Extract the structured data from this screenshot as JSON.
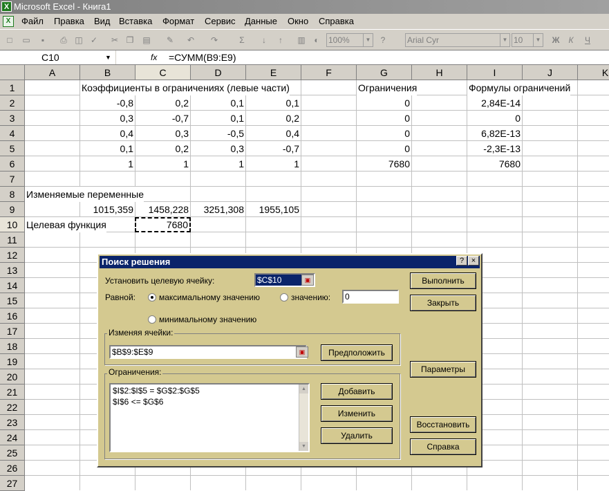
{
  "window": {
    "title": "Microsoft Excel - Книга1"
  },
  "menu": [
    "Файл",
    "Правка",
    "Вид",
    "Вставка",
    "Формат",
    "Сервис",
    "Данные",
    "Окно",
    "Справка"
  ],
  "toolbar": {
    "zoom": "100%",
    "font": "Arial Cyr",
    "size": "10",
    "bold": "Ж",
    "italic": "К",
    "underline": "Ч"
  },
  "formula_bar": {
    "name_box": "C10",
    "fx": "fx",
    "formula": "=СУММ(B9:E9)"
  },
  "columns": [
    "A",
    "B",
    "C",
    "D",
    "E",
    "F",
    "G",
    "H",
    "I",
    "J",
    "K"
  ],
  "rows": [
    "1",
    "2",
    "3",
    "4",
    "5",
    "6",
    "7",
    "8",
    "9",
    "10",
    "11",
    "12",
    "13",
    "14",
    "15",
    "16",
    "17",
    "18",
    "19",
    "20",
    "21",
    "22",
    "23",
    "24",
    "25",
    "26",
    "27"
  ],
  "cells": {
    "b1": "Коэффициенты в ограничениях (левые части)",
    "g1": "Ограничения",
    "i1": "Формулы ограничений",
    "b2": "-0,8",
    "c2": "0,2",
    "d2": "0,1",
    "e2": "0,1",
    "g2": "0",
    "i2": "2,84E-14",
    "b3": "0,3",
    "c3": "-0,7",
    "d3": "0,1",
    "e3": "0,2",
    "g3": "0",
    "i3": "0",
    "b4": "0,4",
    "c4": "0,3",
    "d4": "-0,5",
    "e4": "0,4",
    "g4": "0",
    "i4": "6,82E-13",
    "b5": "0,1",
    "c5": "0,2",
    "d5": "0,3",
    "e5": "-0,7",
    "g5": "0",
    "i5": "-2,3E-13",
    "b6": "1",
    "c6": "1",
    "d6": "1",
    "e6": "1",
    "g6": "7680",
    "i6": "7680",
    "a8": "Изменяемые переменные",
    "b9": "1015,359",
    "c9": "1458,228",
    "d9": "3251,308",
    "e9": "1955,105",
    "a10": "Целевая функция",
    "c10": "7680"
  },
  "dialog": {
    "title": "Поиск решения",
    "help_btn": "?",
    "close_btn": "×",
    "target_label": "Установить целевую ячейку:",
    "target_value": "$C$10",
    "equal_label": "Равной:",
    "opt_max": "максимальному значению",
    "opt_value": "значению:",
    "value_input": "0",
    "opt_min": "минимальному значению",
    "changing_label": "Изменяя ячейки:",
    "changing_value": "$B$9:$E$9",
    "guess_btn": "Предположить",
    "constraints_label": "Ограничения:",
    "constraints": [
      "$I$2:$I$5 = $G$2:$G$5",
      "$I$6 <= $G$6"
    ],
    "add_btn": "Добавить",
    "change_btn": "Изменить",
    "delete_btn": "Удалить",
    "solve_btn": "Выполнить",
    "close_action_btn": "Закрыть",
    "options_btn": "Параметры",
    "reset_btn": "Восстановить",
    "help_action_btn": "Справка"
  }
}
